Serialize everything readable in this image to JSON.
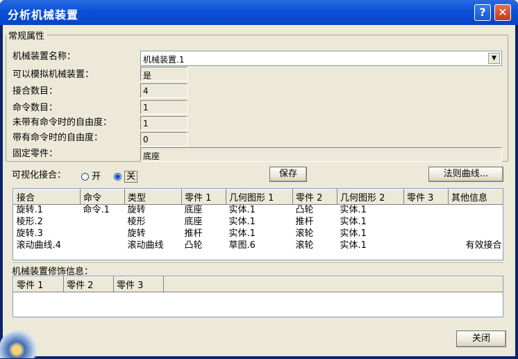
{
  "window": {
    "title": "分析机械装置"
  },
  "general": {
    "legend": "常规属性",
    "name_label": "机械装置名称：",
    "name_value": "机械装置.1",
    "simulate_label": "可以模拟机械装置：",
    "simulate_value": "是",
    "joints_label": "接合数目：",
    "joints_value": "4",
    "commands_label": "命令数目：",
    "commands_value": "1",
    "dof_without_label": "未带有命令时的自由度：",
    "dof_without_value": "1",
    "dof_with_label": "带有命令时的自由度：",
    "dof_with_value": "0",
    "fixed_part_label": "固定零件：",
    "fixed_part_value": "底座"
  },
  "visualize": {
    "label": "可视化接合：",
    "on_label": "开",
    "off_label": "关",
    "selected": "关"
  },
  "buttons": {
    "save": "保存",
    "laws": "法则曲线...",
    "close": "关闭"
  },
  "joints_table": {
    "columns": [
      "接合",
      "命令",
      "类型",
      "零件 1",
      "几何图形 1",
      "零件 2",
      "几何图形 2",
      "零件 3",
      "其他信息"
    ],
    "rows": [
      [
        "旋转.1",
        "命令.1",
        "旋转",
        "底座",
        "实体.1",
        "凸轮",
        "实体.1",
        "",
        ""
      ],
      [
        "棱形.2",
        "",
        "棱形",
        "底座",
        "实体.1",
        "推杆",
        "实体.1",
        "",
        ""
      ],
      [
        "旋转.3",
        "",
        "旋转",
        "推杆",
        "实体.1",
        "滚轮",
        "实体.1",
        "",
        ""
      ],
      [
        "滚动曲线.4",
        "",
        "滚动曲线",
        "凸轮",
        "草图.6",
        "滚轮",
        "实体.1",
        "",
        "有效接合"
      ]
    ]
  },
  "dressup": {
    "label": "机械装置修饰信息：",
    "columns": [
      "零件 1",
      "零件 2",
      "零件 3"
    ]
  }
}
